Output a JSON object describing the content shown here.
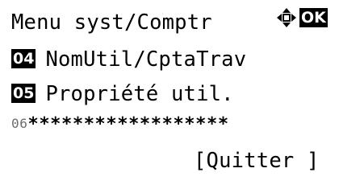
{
  "header": {
    "title": "Menu syst/Comptr",
    "nav_icon": "four-way-arrow-icon",
    "ok_label": "OK"
  },
  "menu": {
    "items": [
      {
        "number": "04",
        "label": "NomUtil/CptaTrav"
      },
      {
        "number": "05",
        "label": "Propriété util."
      }
    ],
    "partial_row_prefix": "06",
    "partial_row_asterisks": "******************"
  },
  "softkey": {
    "quit_label": "[Quitter ]"
  }
}
